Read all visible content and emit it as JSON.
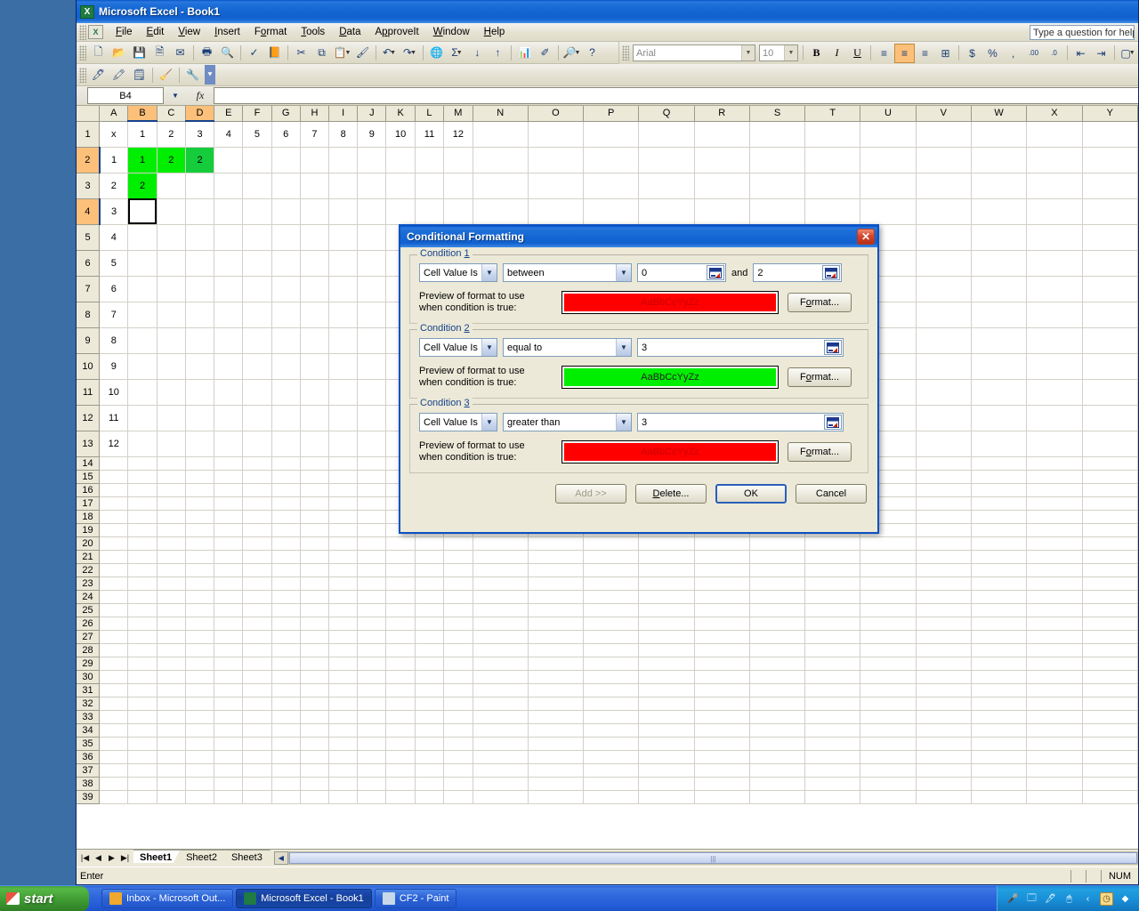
{
  "window": {
    "title": "Microsoft Excel - Book1",
    "app_icon": "excel-icon"
  },
  "menubar": {
    "items": [
      "File",
      "Edit",
      "View",
      "Insert",
      "Format",
      "Tools",
      "Data",
      "ApproveIt",
      "Window",
      "Help"
    ],
    "ask_box_text": "Type a question for help"
  },
  "toolbars": {
    "standard": [
      {
        "icon": "new-icon"
      },
      {
        "icon": "open-icon"
      },
      {
        "icon": "save-icon"
      },
      {
        "icon": "permission-icon"
      },
      {
        "icon": "email-icon"
      },
      {
        "sep": true
      },
      {
        "icon": "print-icon"
      },
      {
        "icon": "print-preview-icon"
      },
      {
        "sep": true
      },
      {
        "icon": "spelling-icon"
      },
      {
        "icon": "research-icon"
      },
      {
        "sep": true
      },
      {
        "icon": "cut-icon"
      },
      {
        "icon": "copy-icon"
      },
      {
        "icon": "paste-icon",
        "caret": true
      },
      {
        "icon": "format-painter-icon"
      },
      {
        "sep": true
      },
      {
        "icon": "undo-icon",
        "caret": true
      },
      {
        "icon": "redo-icon",
        "caret": true
      },
      {
        "sep": true
      },
      {
        "icon": "hyperlink-icon"
      },
      {
        "icon": "autosum-icon",
        "caret": true
      },
      {
        "icon": "sort-asc-icon"
      },
      {
        "icon": "sort-desc-icon"
      },
      {
        "sep": true
      },
      {
        "icon": "chart-wizard-icon"
      },
      {
        "icon": "drawing-icon"
      },
      {
        "sep": true
      },
      {
        "icon": "zoom-icon",
        "caret": true
      },
      {
        "icon": "help-icon"
      }
    ],
    "drawing": [
      {
        "icon": "pen-icon"
      },
      {
        "icon": "highlighter-icon"
      },
      {
        "icon": "stamp-icon"
      },
      {
        "sep": true
      },
      {
        "icon": "eraser-icon"
      },
      {
        "sep": true
      },
      {
        "icon": "settings-icon"
      }
    ],
    "formatting": {
      "font_name": "Arial",
      "font_size": "10",
      "buttons": [
        {
          "icon": "bold-icon",
          "label": "B"
        },
        {
          "icon": "italic-icon",
          "label": "I"
        },
        {
          "icon": "underline-icon",
          "label": "U"
        },
        {
          "sep": true
        },
        {
          "icon": "align-left-icon"
        },
        {
          "icon": "align-center-icon",
          "active": true
        },
        {
          "icon": "align-right-icon"
        },
        {
          "icon": "merge-center-icon"
        },
        {
          "sep": true
        },
        {
          "icon": "currency-icon",
          "label": "$"
        },
        {
          "icon": "percent-icon",
          "label": "%"
        },
        {
          "icon": "comma-icon",
          "label": ","
        },
        {
          "sep": true
        },
        {
          "icon": "increase-decimal-icon"
        },
        {
          "icon": "decrease-decimal-icon"
        },
        {
          "sep": true
        },
        {
          "icon": "decrease-indent-icon"
        },
        {
          "icon": "increase-indent-icon"
        },
        {
          "sep": true
        },
        {
          "icon": "borders-icon",
          "caret": true
        }
      ]
    }
  },
  "formula_bar": {
    "name_box": "B4",
    "formula": "",
    "fx_label": "fx"
  },
  "grid": {
    "column_headers": [
      "A",
      "B",
      "C",
      "D",
      "E",
      "F",
      "G",
      "H",
      "I",
      "J",
      "K",
      "L",
      "M",
      "N",
      "O",
      "P",
      "Q",
      "R",
      "S",
      "T",
      "U",
      "V",
      "W",
      "X",
      "Y"
    ],
    "selected_columns": [
      "B",
      "D"
    ],
    "selected_rows": [
      2,
      4
    ],
    "row_count_visible": 39,
    "rows": [
      {
        "n": 1,
        "cells": {
          "A": "x",
          "B": "1",
          "C": "2",
          "D": "3",
          "E": "4",
          "F": "5",
          "G": "6",
          "H": "7",
          "I": "8",
          "J": "9",
          "K": "10",
          "L": "11",
          "M": "12"
        }
      },
      {
        "n": 2,
        "cells": {
          "A": "1",
          "B": "1",
          "C": "2",
          "D": "2"
        }
      },
      {
        "n": 3,
        "cells": {
          "A": "2",
          "B": "2"
        }
      },
      {
        "n": 4,
        "cells": {
          "A": "3"
        }
      },
      {
        "n": 5,
        "cells": {
          "A": "4"
        }
      },
      {
        "n": 6,
        "cells": {
          "A": "5"
        }
      },
      {
        "n": 7,
        "cells": {
          "A": "6"
        }
      },
      {
        "n": 8,
        "cells": {
          "A": "7"
        }
      },
      {
        "n": 9,
        "cells": {
          "A": "8"
        }
      },
      {
        "n": 10,
        "cells": {
          "A": "9"
        }
      },
      {
        "n": 11,
        "cells": {
          "A": "10"
        }
      },
      {
        "n": 12,
        "cells": {
          "A": "11"
        }
      },
      {
        "n": 13,
        "cells": {
          "A": "12"
        }
      }
    ],
    "green_cells": [
      "B2",
      "C2",
      "B3"
    ],
    "selected_green_cell": "D2",
    "active_cell": "B4",
    "colors": {
      "green_fill": "#00ee00",
      "green_selected": "#14cc3c",
      "header_selected": "#fcc07a"
    }
  },
  "sheet_tabs": {
    "tabs": [
      "Sheet1",
      "Sheet2",
      "Sheet3"
    ],
    "active": "Sheet1",
    "nav_first": "first-sheet-icon",
    "nav_prev": "prev-sheet-icon",
    "nav_next": "next-sheet-icon",
    "nav_last": "last-sheet-icon"
  },
  "status_bar": {
    "mode": "Enter",
    "num_lock": "NUM"
  },
  "dialog": {
    "title": "Conditional Formatting",
    "close_icon": "close-icon",
    "preview_label_line1": "Preview of format to use",
    "preview_label_line2": "when condition is true:",
    "preview_text": "AaBbCcYyZz",
    "format_button": "Format...",
    "and_label": "and",
    "range_icon": "range-selector-icon",
    "conditions": [
      {
        "legend": "Condition 1",
        "legend_num": "1",
        "operand": "Cell Value Is",
        "comparison": "between",
        "value1": "0",
        "value2": "2",
        "has_second_value": true,
        "preview_bg": "#ff0000",
        "preview_fg": "#cc0000"
      },
      {
        "legend": "Condition 2",
        "legend_num": "2",
        "operand": "Cell Value Is",
        "comparison": "equal to",
        "value1": "3",
        "value2": "",
        "has_second_value": false,
        "preview_bg": "#00ee00",
        "preview_fg": "#222222"
      },
      {
        "legend": "Condition 3",
        "legend_num": "3",
        "operand": "Cell Value Is",
        "comparison": "greater than",
        "value1": "3",
        "value2": "",
        "has_second_value": false,
        "preview_bg": "#ff0000",
        "preview_fg": "#cc0000"
      }
    ],
    "buttons": {
      "add": "Add >>",
      "delete": "Delete...",
      "ok": "OK",
      "cancel": "Cancel"
    }
  },
  "taskbar": {
    "start_label": "start",
    "tasks": [
      {
        "label": "Inbox - Microsoft Out...",
        "icon": "outlook-icon",
        "active": false
      },
      {
        "label": "Microsoft Excel - Book1",
        "icon": "excel-icon",
        "active": true
      },
      {
        "label": "CF2 - Paint",
        "icon": "paint-icon",
        "active": false
      }
    ],
    "tray_icons": [
      "microphone-icon",
      "language-bar-icon",
      "pen-input-icon",
      "tablet-icon",
      "show-hidden-icon",
      "clock-icon",
      "network-icon"
    ]
  }
}
